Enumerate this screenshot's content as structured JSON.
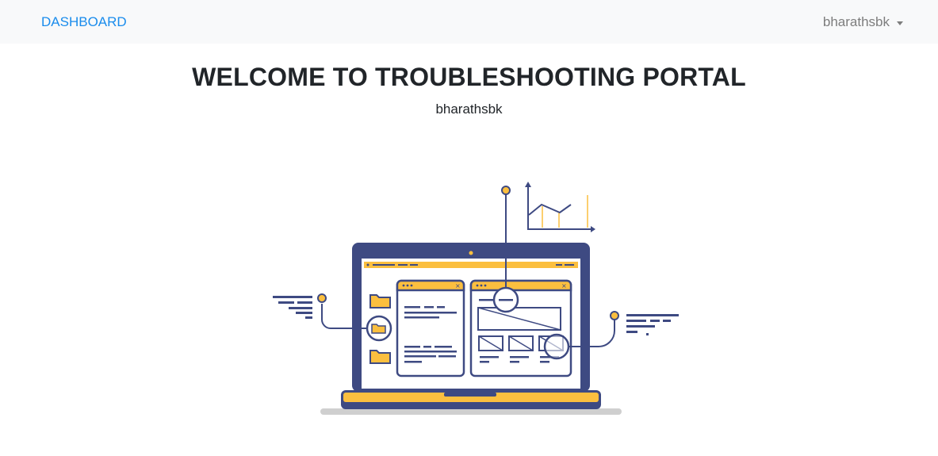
{
  "navbar": {
    "brand": "DASHBOARD",
    "user": "bharathsbk"
  },
  "main": {
    "title": "WELCOME TO TROUBLESHOOTING PORTAL",
    "subtitle": "bharathsbk"
  },
  "illustration": {
    "name": "laptop-troubleshooting-illustration",
    "colors": {
      "navy": "#3e4a82",
      "yellow": "#fbbf3f",
      "gray": "#cfcfcf",
      "white": "#ffffff"
    }
  }
}
